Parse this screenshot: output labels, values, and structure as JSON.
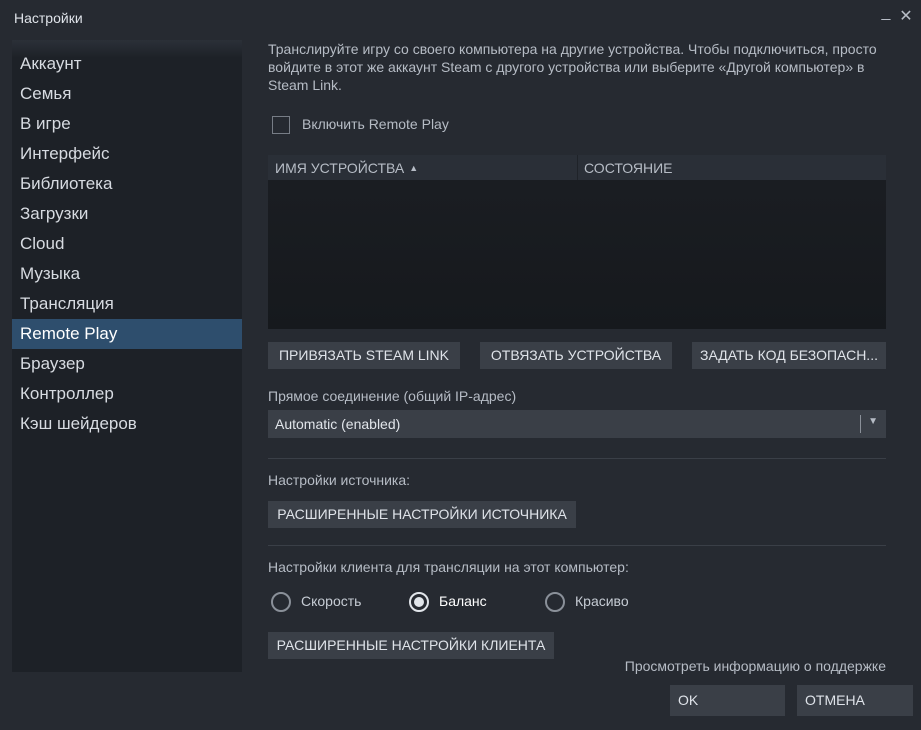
{
  "window": {
    "title": "Настройки",
    "minimize_glyph": "_",
    "close_glyph": "✕"
  },
  "sidebar": {
    "items": [
      {
        "label": "Аккаунт"
      },
      {
        "label": "Семья"
      },
      {
        "label": "В игре"
      },
      {
        "label": "Интерфейс"
      },
      {
        "label": "Библиотека"
      },
      {
        "label": "Загрузки"
      },
      {
        "label": "Cloud"
      },
      {
        "label": "Музыка"
      },
      {
        "label": "Трансляция"
      },
      {
        "label": "Remote Play",
        "active": true
      },
      {
        "label": "Браузер"
      },
      {
        "label": "Контроллер"
      },
      {
        "label": "Кэш шейдеров"
      }
    ]
  },
  "main": {
    "intro": "Транслируйте игру со своего компьютера на другие устройства. Чтобы подключиться, просто войдите в этот же аккаунт Steam с другого устройства или выберите «Другой компьютер» в Steam Link.",
    "enable_checkbox": {
      "label": "Включить Remote Play",
      "checked": false
    },
    "devices_table": {
      "columns": [
        "ИМЯ УСТРОЙСТВА",
        "СОСТОЯНИЕ"
      ],
      "sort_indicator": "▲",
      "rows": []
    },
    "buttons": {
      "link_steam_link": "ПРИВЯЗАТЬ STEAM LINK",
      "unlink_devices": "ОТВЯЗАТЬ УСТРОЙСТВА",
      "set_security_code": "ЗАДАТЬ КОД БЕЗОПАСН..."
    },
    "direct_connection": {
      "label": "Прямое соединение (общий IP-адрес)",
      "selected": "Automatic (enabled)"
    },
    "source_settings": {
      "label": "Настройки источника:",
      "advanced_button": "РАСШИРЕННЫЕ НАСТРОЙКИ ИСТОЧНИКА"
    },
    "client_settings": {
      "label": "Настройки клиента для трансляции на этот компьютер:",
      "options": [
        {
          "label": "Скорость",
          "selected": false
        },
        {
          "label": "Баланс",
          "selected": true
        },
        {
          "label": "Красиво",
          "selected": false
        }
      ],
      "advanced_button": "РАСШИРЕННЫЕ НАСТРОЙКИ КЛИЕНТА"
    },
    "support_link": "Просмотреть информацию о поддержке"
  },
  "footer": {
    "ok": "OK",
    "cancel": "ОТМЕНА"
  },
  "colors": {
    "window_bg": "#262a31",
    "sidebar_bg": "#1d2127",
    "active_item_bg": "#2e4e6d",
    "button_bg": "#3a3f47"
  }
}
